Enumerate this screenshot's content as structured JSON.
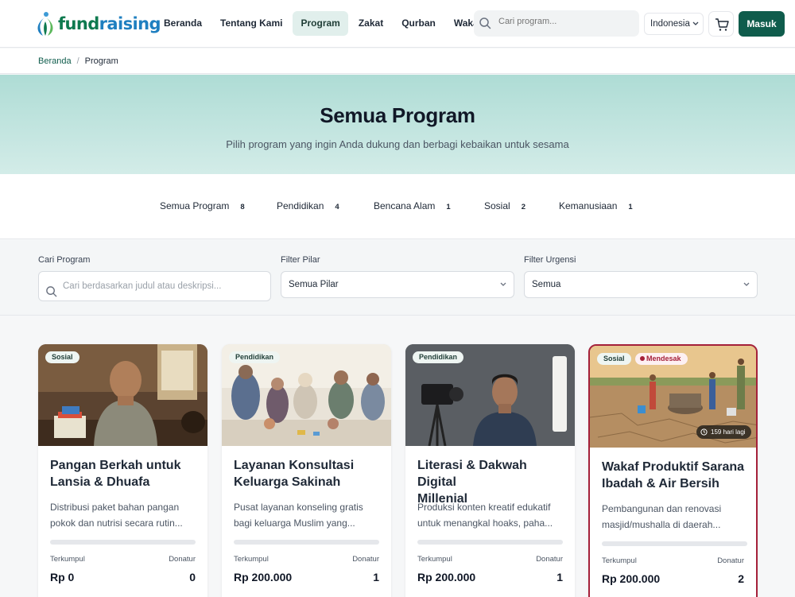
{
  "header": {
    "logo_text_a": "fund",
    "logo_text_b": "raising",
    "nav": [
      "Beranda",
      "Tentang Kami",
      "Program",
      "Zakat",
      "Qurban",
      "Wakaf"
    ],
    "active_nav": "Program",
    "search_placeholder": "Cari program...",
    "language": "Indonesia",
    "login_label": "Masuk"
  },
  "breadcrumb": {
    "home": "Beranda",
    "separator": "/",
    "current": "Program"
  },
  "hero": {
    "title": "Semua Program",
    "subtitle": "Pilih program yang ingin Anda dukung dan berbagi kebaikan untuk sesama"
  },
  "tabs": [
    {
      "label": "Semua Program",
      "count": "8"
    },
    {
      "label": "Pendidikan",
      "count": "4"
    },
    {
      "label": "Bencana Alam",
      "count": "1"
    },
    {
      "label": "Sosial",
      "count": "2"
    },
    {
      "label": "Kemanusiaan",
      "count": "1"
    }
  ],
  "filters": {
    "search_label": "Cari Program",
    "search_placeholder": "Cari berdasarkan judul atau deskripsi...",
    "pillar_label": "Filter Pilar",
    "pillar_value": "Semua Pilar",
    "urgency_label": "Filter Urgensi",
    "urgency_value": "Semua"
  },
  "cards": [
    {
      "category": "Sosial",
      "urgent": "",
      "days_left": "",
      "title_1": "Pangan Berkah untuk",
      "title_2": "Lansia & Dhuafa",
      "desc_1": "Distribusi paket bahan pangan",
      "desc_2": "pokok dan nutrisi secara rutin...",
      "collected_label": "Terkumpul",
      "donor_label": "Donatur",
      "collected": "Rp 0",
      "donors": "0",
      "progress": 0
    },
    {
      "category": "Pendidikan",
      "urgent": "",
      "days_left": "",
      "title_1": "Layanan Konsultasi",
      "title_2": "Keluarga Sakinah",
      "desc_1": "Pusat layanan konseling gratis",
      "desc_2": "bagi keluarga Muslim yang...",
      "collected_label": "Terkumpul",
      "donor_label": "Donatur",
      "collected": "Rp 200.000",
      "donors": "1",
      "progress": 0
    },
    {
      "category": "Pendidikan",
      "urgent": "",
      "days_left": "",
      "title_1": "Literasi & Dakwah Digital",
      "title_2": "Millenial",
      "desc_1": "Produksi konten kreatif edukatif",
      "desc_2": "untuk menangkal hoaks, paha...",
      "collected_label": "Terkumpul",
      "donor_label": "Donatur",
      "collected": "Rp 200.000",
      "donors": "1",
      "progress": 0
    },
    {
      "category": "Sosial",
      "urgent": "Mendesak",
      "days_left": "159 hari lagi",
      "title_1": "Wakaf Produktif Sarana",
      "title_2": "Ibadah & Air Bersih",
      "desc_1": "Pembangunan dan renovasi",
      "desc_2": "masjid/mushalla di daerah...",
      "collected_label": "Terkumpul",
      "donor_label": "Donatur",
      "collected": "Rp 200.000",
      "donors": "2",
      "progress": 0
    }
  ],
  "colors": {
    "primary": "#0f5c4c",
    "urgent": "#a5213a",
    "hero": "#aedcd5"
  }
}
